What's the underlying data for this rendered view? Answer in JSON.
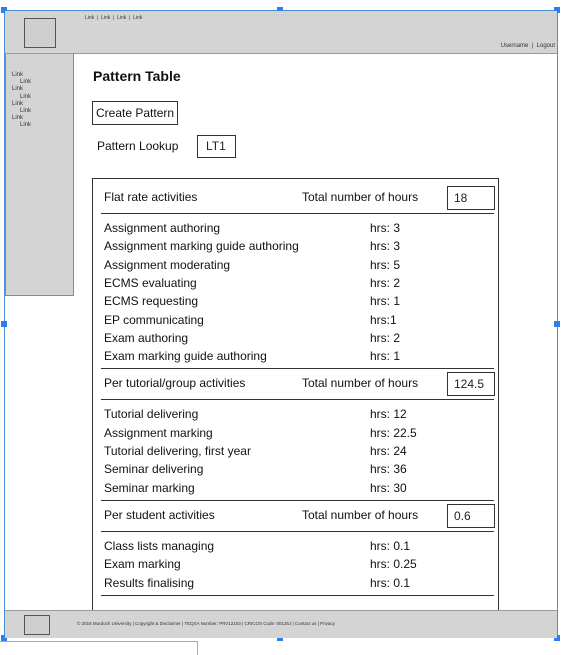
{
  "header": {
    "links": [
      "Link",
      "Link",
      "Link",
      "Link"
    ],
    "username": "Username",
    "logout": "Logout"
  },
  "sidebar": {
    "items": [
      {
        "label": "Link",
        "sub": false
      },
      {
        "label": "Link",
        "sub": true
      },
      {
        "label": "Link",
        "sub": false
      },
      {
        "label": "Link",
        "sub": true
      },
      {
        "label": "Link",
        "sub": false
      },
      {
        "label": "Link",
        "sub": true
      },
      {
        "label": "Link",
        "sub": false
      },
      {
        "label": "Link",
        "sub": true
      }
    ]
  },
  "main": {
    "title": "Pattern Table",
    "create_button": "Create Pattern",
    "lookup_label": "Pattern Lookup",
    "lookup_value": "LT1"
  },
  "sections": [
    {
      "header": "Flat rate activities",
      "total_label": "Total number of hours",
      "total": "18",
      "rows": [
        {
          "name": "Assignment authoring",
          "hrs": "hrs: 3"
        },
        {
          "name": "Assignment marking guide authoring",
          "hrs": "hrs: 3"
        },
        {
          "name": "Assignment moderating",
          "hrs": "hrs: 5"
        },
        {
          "name": "ECMS evaluating",
          "hrs": "hrs: 2"
        },
        {
          "name": "ECMS requesting",
          "hrs": "hrs: 1"
        },
        {
          "name": "EP communicating",
          "hrs": "hrs:1"
        },
        {
          "name": "Exam authoring",
          "hrs": "hrs: 2"
        },
        {
          "name": "Exam marking guide authoring",
          "hrs": "hrs: 1"
        }
      ]
    },
    {
      "header": "Per tutorial/group activities",
      "total_label": "Total number of hours",
      "total": "124.5",
      "rows": [
        {
          "name": "Tutorial delivering",
          "hrs": "hrs: 12"
        },
        {
          "name": "Assignment  marking",
          "hrs": "hrs: 22.5"
        },
        {
          "name": "Tutorial delivering, first year",
          "hrs": "hrs: 24"
        },
        {
          "name": "Seminar delivering",
          "hrs": "hrs: 36"
        },
        {
          "name": "Seminar marking",
          "hrs": "hrs: 30"
        }
      ]
    },
    {
      "header": "Per student activities",
      "total_label": "Total number of hours",
      "total": "0.6",
      "rows": [
        {
          "name": "Class lists managing",
          "hrs": "hrs: 0.1"
        },
        {
          "name": "Exam marking",
          "hrs": "hrs: 0.25"
        },
        {
          "name": "Results finalising",
          "hrs": "hrs: 0.1"
        }
      ]
    }
  ],
  "footer": {
    "text": "© 2016 Murdoch University   |   Copyright & Disclaimer   |   TEQSA Number: PRV12163   |   CRICOS Code: 00125J   |   Contact us   |   Privacy"
  },
  "colors": {
    "chrome_gray": "#d4d4d4",
    "selection_blue": "#2d7ff0"
  }
}
